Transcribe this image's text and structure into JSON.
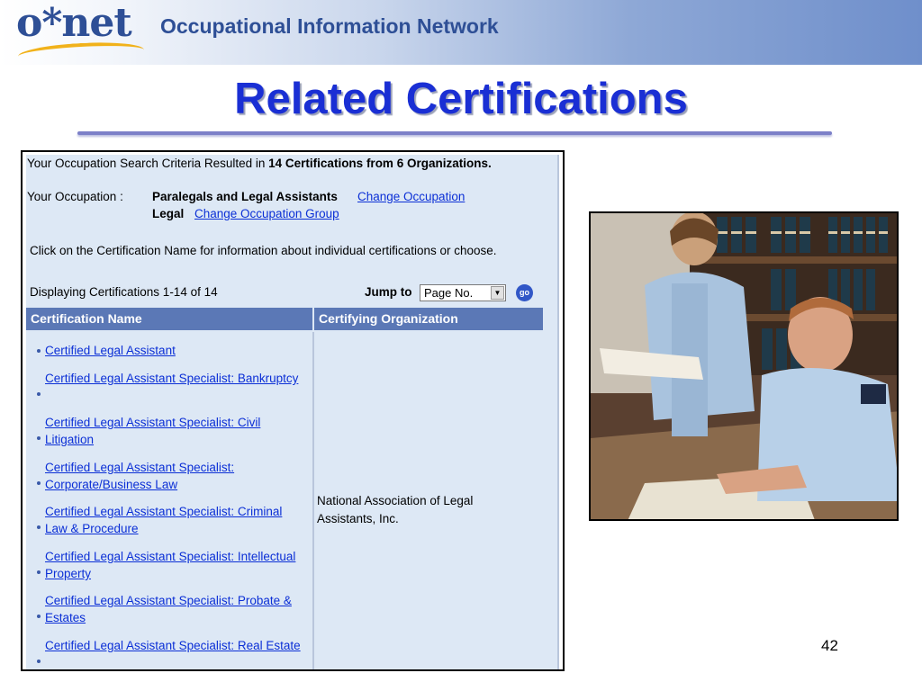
{
  "header": {
    "logo_text": "o*net",
    "network_name": "Occupational Information Network"
  },
  "slide": {
    "title": "Related Certifications",
    "page_number": "42"
  },
  "panel": {
    "summary_prefix": "Your Occupation Search Criteria Resulted in",
    "summary_bold": "14 Certifications from 6 Organizations.",
    "occupation_label": "Your Occupation :",
    "occupation_value": "Paralegals and Legal Assistants",
    "change_occupation_link": "Change Occupation",
    "group_value": "Legal",
    "change_group_link": "Change Occupation Group",
    "instruction": "Click on the Certification Name for information about individual certifications or choose.",
    "displaying": "Displaying Certifications 1-14 of 14",
    "jump_label": "Jump to",
    "jump_select_value": "Page No.",
    "go_label": "go",
    "table": {
      "col_name": "Certification Name",
      "col_org": "Certifying Organization",
      "organization": "National Association of Legal Assistants, Inc.",
      "certifications": [
        "Certified Legal Assistant",
        "Certified Legal Assistant Specialist: Bankruptcy",
        "Certified Legal Assistant Specialist: Civil Litigation",
        "Certified Legal Assistant Specialist: Corporate/Business Law",
        "Certified Legal Assistant Specialist: Criminal Law & Procedure",
        "Certified Legal Assistant Specialist: Intellectual Property",
        "Certified Legal Assistant Specialist: Probate & Estates",
        "Certified Legal Assistant Specialist: Real Estate"
      ]
    }
  },
  "colors": {
    "title": "#1a2fd4",
    "link": "#0b2fd6",
    "table_header": "#5b78b6",
    "panel_bg": "#dde8f5",
    "brand": "#2e4f96"
  },
  "photo": {
    "icon": "photo-legal-staff"
  }
}
